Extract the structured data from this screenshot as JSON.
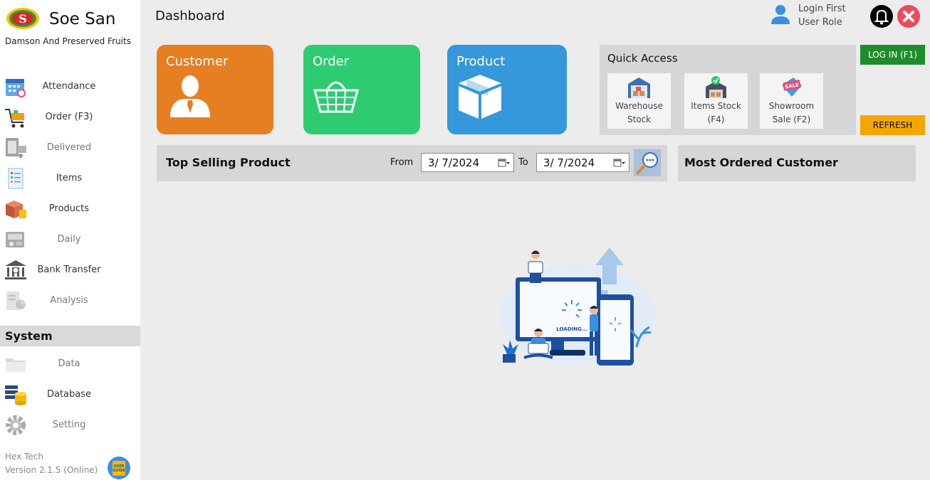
{
  "brand": {
    "name": "Soe San",
    "tagline": "Damson And Preserved Fruits"
  },
  "sidebar": {
    "items": [
      {
        "label": "Attendance",
        "icon": "calendar-icon"
      },
      {
        "label": "Order (F3)",
        "icon": "shopping-cart-icon"
      },
      {
        "label": "Delivered",
        "icon": "delivery-icon"
      },
      {
        "label": "Items",
        "icon": "checklist-icon"
      },
      {
        "label": "Products",
        "icon": "box-icon"
      },
      {
        "label": "Daily",
        "icon": "cash-register-icon"
      },
      {
        "label": "Bank Transfer",
        "icon": "bank-icon"
      },
      {
        "label": "Analysis",
        "icon": "report-chart-icon"
      }
    ],
    "system_title": "System",
    "system_items": [
      {
        "label": "Data",
        "icon": "folder-icon"
      },
      {
        "label": "Database",
        "icon": "database-icon"
      },
      {
        "label": "Setting",
        "icon": "gear-icon"
      }
    ],
    "company": "Hex Tech",
    "version": "Version 2.1.5 (Online)",
    "user_guide_label": "USER GUIDE"
  },
  "header": {
    "title": "Dashboard",
    "user_name": "Login First",
    "user_role": "User Role"
  },
  "tiles": [
    {
      "label": "Customer",
      "color": "#e67e22"
    },
    {
      "label": "Order",
      "color": "#2ecc71"
    },
    {
      "label": "Product",
      "color": "#3498db"
    }
  ],
  "quick_access": {
    "title": "Quick Access",
    "buttons": [
      {
        "line1": "Warehouse",
        "line2": "Stock",
        "icon": "warehouse-icon"
      },
      {
        "line1": "Items Stock",
        "line2": "(F4)",
        "icon": "items-stock-icon"
      },
      {
        "line1": "Showroom",
        "line2": "Sale (F2)",
        "icon": "sale-tag-icon"
      }
    ]
  },
  "actions": {
    "login": "LOG IN (F1)",
    "refresh": "REFRESH"
  },
  "top_selling": {
    "title": "Top Selling Product",
    "from_label": "From",
    "from_date": "3/  7/2024",
    "to_label": "To",
    "to_date": "3/  7/2024"
  },
  "most_ordered": {
    "title": "Most Ordered Customer"
  },
  "loading": {
    "text": "LOADING..."
  },
  "colors": {
    "accent_green": "#1e8c2b",
    "accent_orange": "#f5a500",
    "close_red": "#ea4b5e"
  }
}
